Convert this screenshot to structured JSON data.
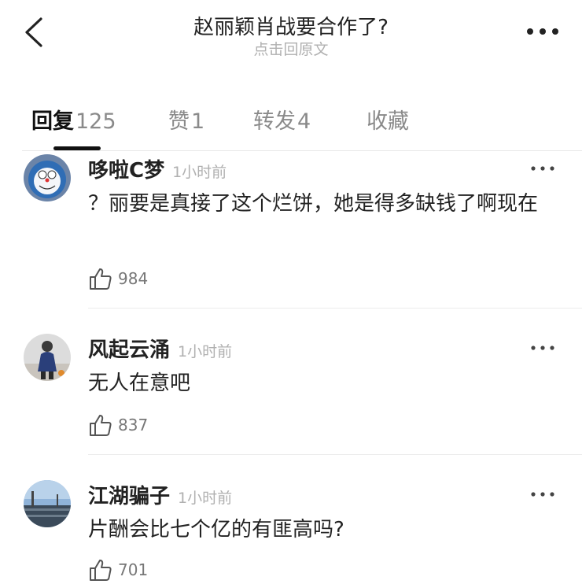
{
  "header": {
    "title": "赵丽颖肖战要合作了?",
    "subtitle": "点击回原文"
  },
  "tabs": [
    {
      "label": "回复",
      "count": "125",
      "active": true
    },
    {
      "label": "赞",
      "count": "1",
      "active": false
    },
    {
      "label": "转发",
      "count": "4",
      "active": false
    },
    {
      "label": "收藏",
      "count": "",
      "active": false
    }
  ],
  "comments": [
    {
      "user": "哆啦C梦",
      "time": "1小时前",
      "text": "？丽要是真接了这个烂饼，她是得多缺钱了啊现在",
      "likes": "984"
    },
    {
      "user": "风起云涌",
      "time": "1小时前",
      "text": "无人在意吧",
      "likes": "837"
    },
    {
      "user": "江湖骗子",
      "time": "1小时前",
      "text": "片酬会比七个亿的有匪高吗?",
      "likes": "701"
    }
  ],
  "icons": {
    "back": "chevron-left-icon",
    "more": "more-dots-icon",
    "like": "thumbs-up-icon"
  },
  "colors": {
    "primary_text": "#222222",
    "secondary_text": "#b0b0b0",
    "active_indicator": "#111111"
  }
}
